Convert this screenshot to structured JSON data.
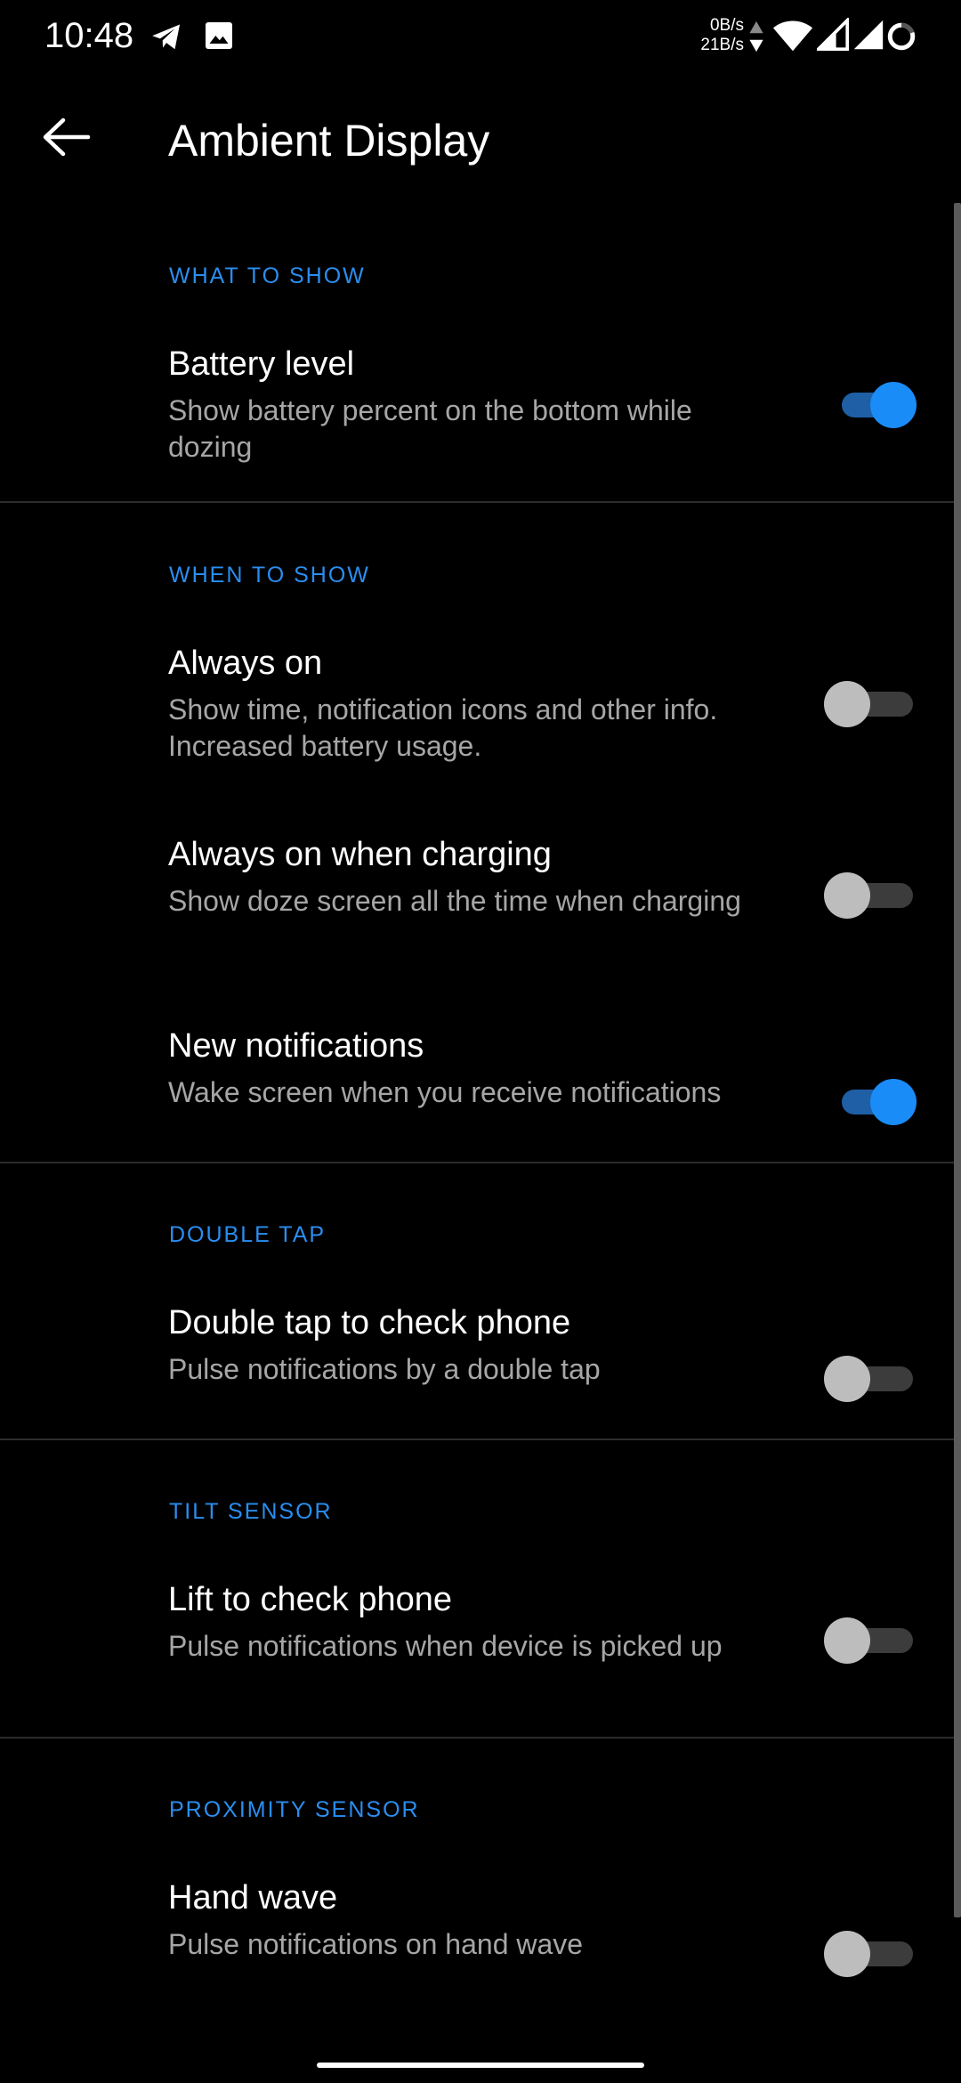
{
  "status_bar": {
    "time": "10:48",
    "net_up": "0B/s",
    "net_down": "21B/s",
    "icons": [
      "telegram-icon",
      "gallery-icon",
      "data-arrows-icon",
      "wifi-icon",
      "signal-icon",
      "signal-icon",
      "battery-ring-icon"
    ]
  },
  "app_bar": {
    "title": "Ambient Display",
    "back_icon": "arrow-left-icon"
  },
  "colors": {
    "background": "#000000",
    "accent": "#1a8cf7",
    "section_header": "#2a8ef0",
    "summary_text": "#a6a6a6"
  },
  "sections": [
    {
      "header": "WHAT TO SHOW",
      "items": [
        {
          "title": "Battery level",
          "summary": "Show battery percent on the bottom while dozing",
          "enabled": true
        }
      ]
    },
    {
      "header": "WHEN TO SHOW",
      "items": [
        {
          "title": "Always on",
          "summary": "Show time, notification icons and other info. Increased battery usage.",
          "enabled": false
        },
        {
          "title": "Always on when charging",
          "summary": "Show doze screen all the time when charging",
          "enabled": false
        },
        {
          "title": "New notifications",
          "summary": "Wake screen when you receive notifications",
          "enabled": true
        }
      ]
    },
    {
      "header": "DOUBLE TAP",
      "items": [
        {
          "title": "Double tap to check phone",
          "summary": "Pulse notifications by a double tap",
          "enabled": false
        }
      ]
    },
    {
      "header": "TILT SENSOR",
      "items": [
        {
          "title": "Lift to check phone",
          "summary": "Pulse notifications when device is picked up",
          "enabled": false
        }
      ]
    },
    {
      "header": "PROXIMITY SENSOR",
      "items": [
        {
          "title": "Hand wave",
          "summary": "Pulse notifications on hand wave",
          "enabled": false
        }
      ]
    }
  ]
}
